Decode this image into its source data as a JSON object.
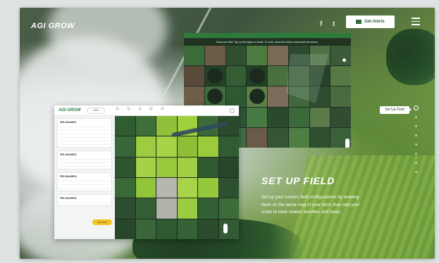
{
  "header": {
    "logo": "AGI GROW",
    "facebook_icon": "f",
    "twitter_icon": "t",
    "alerts_label": "Get Alerts"
  },
  "hero": {
    "title": "SET UP FIELD",
    "body": "Set up your custom field configurations by drawing them on the aerial map of your farm, then add your crops to track related activities and tasks."
  },
  "side_nav": {
    "active_label": "Set Up Field",
    "dot_count": 8
  },
  "map_top": {
    "bar_label": "",
    "hint": "Draw your field. Tap on the edges to create. To undo, press the button underneath the search."
  },
  "app": {
    "logo": "AGI GROW",
    "year": "2019",
    "nav_items": [
      "",
      "",
      "",
      "",
      ""
    ],
    "add_button": "Add Field",
    "farms": [
      {
        "name": "FIELDNAME01",
        "lines": [
          "",
          "",
          "",
          "",
          "",
          ""
        ]
      },
      {
        "name": "FIELDNAME02",
        "lines": [
          "",
          "",
          ""
        ]
      },
      {
        "name": "FIELDNAME03",
        "lines": [
          "",
          "",
          ""
        ]
      },
      {
        "name": "FIELDNAME04",
        "lines": [
          ""
        ]
      }
    ],
    "field_labels": [
      "",
      "",
      "",
      "",
      "",
      "",
      ""
    ]
  }
}
